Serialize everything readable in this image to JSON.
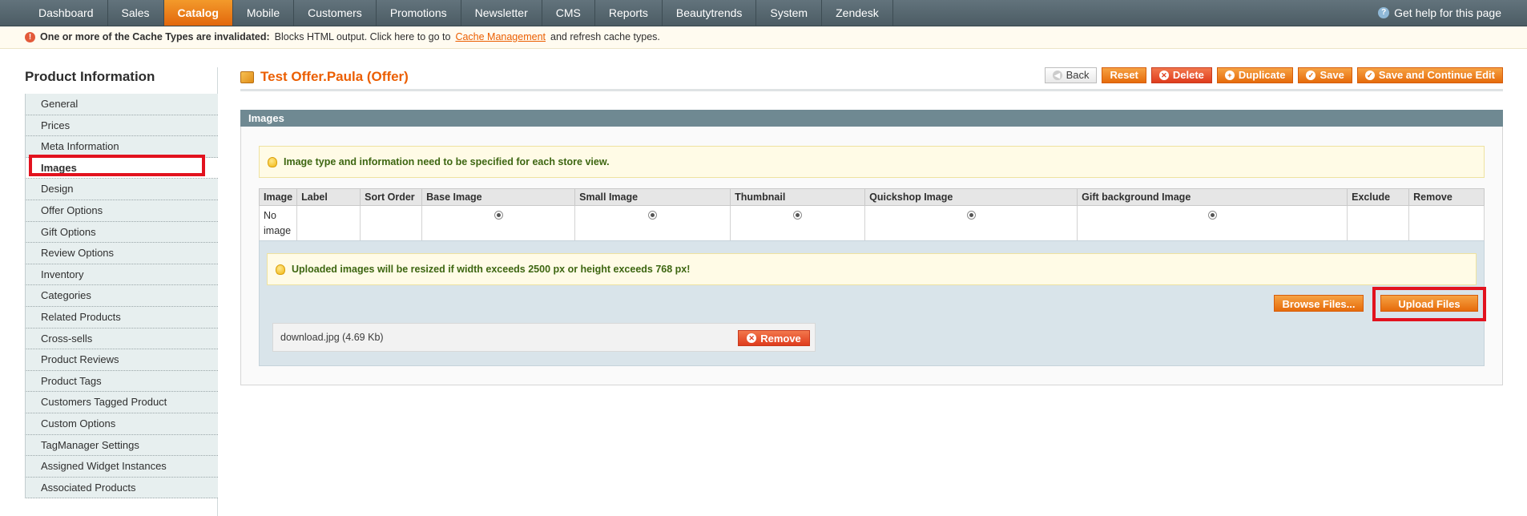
{
  "nav": {
    "items": [
      "Dashboard",
      "Sales",
      "Catalog",
      "Mobile",
      "Customers",
      "Promotions",
      "Newsletter",
      "CMS",
      "Reports",
      "Beautytrends",
      "System",
      "Zendesk"
    ],
    "active": "Catalog",
    "help": "Get help for this page"
  },
  "notice": {
    "bold": "One or more of the Cache Types are invalidated:",
    "text1": "Blocks HTML output. Click here to go to",
    "link": "Cache Management",
    "text2": "and refresh cache types."
  },
  "sidebar": {
    "title": "Product Information",
    "tabs": [
      "General",
      "Prices",
      "Meta Information",
      "Images",
      "Design",
      "Offer Options",
      "Gift Options",
      "Review Options",
      "Inventory",
      "Categories",
      "Related Products",
      "Cross-sells",
      "Product Reviews",
      "Product Tags",
      "Customers Tagged Product",
      "Custom Options",
      "TagManager Settings",
      "Assigned Widget Instances",
      "Associated Products"
    ],
    "active": "Images"
  },
  "header": {
    "title": "Test Offer.Paula (Offer)",
    "buttons": {
      "back": "Back",
      "reset": "Reset",
      "delete": "Delete",
      "duplicate": "Duplicate",
      "save": "Save",
      "save_continue": "Save and Continue Edit"
    }
  },
  "images": {
    "section_title": "Images",
    "tip": "Image type and information need to be specified for each store view.",
    "columns": [
      "Image",
      "Label",
      "Sort Order",
      "Base Image",
      "Small Image",
      "Thumbnail",
      "Quickshop Image",
      "Gift background Image",
      "Exclude",
      "Remove"
    ],
    "row": {
      "image_line1": "No",
      "image_line2": "image"
    },
    "upload_tip": "Uploaded images will be resized if width exceeds 2500 px or height exceeds 768 px!",
    "browse_label": "Browse Files...",
    "upload_label": "Upload Files",
    "file": {
      "name": "download.jpg (4.69 Kb)",
      "remove_label": "Remove"
    }
  },
  "colors": {
    "accent": "#eb5e00",
    "nav": "#566870",
    "highlight": "#e2121e"
  }
}
